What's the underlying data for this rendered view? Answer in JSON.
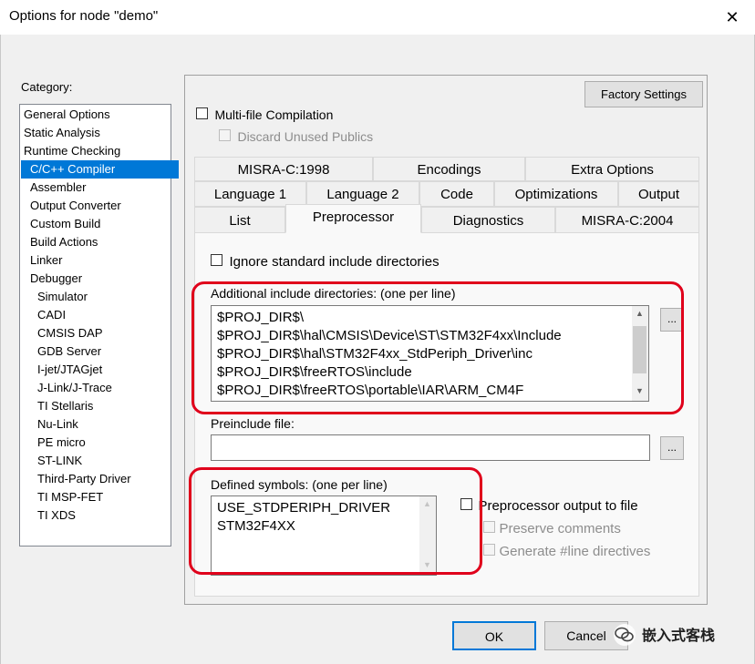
{
  "window": {
    "title": "Options for node \"demo\"",
    "close_glyph": "✕"
  },
  "category": {
    "label": "Category:",
    "items": [
      {
        "label": "General Options",
        "level": 0
      },
      {
        "label": "Static Analysis",
        "level": 0
      },
      {
        "label": "Runtime Checking",
        "level": 0
      },
      {
        "label": "C/C++ Compiler",
        "level": 1,
        "selected": true
      },
      {
        "label": "Assembler",
        "level": 1
      },
      {
        "label": "Output Converter",
        "level": 1
      },
      {
        "label": "Custom Build",
        "level": 1
      },
      {
        "label": "Build Actions",
        "level": 1
      },
      {
        "label": "Linker",
        "level": 1
      },
      {
        "label": "Debugger",
        "level": 1
      },
      {
        "label": "Simulator",
        "level": 2
      },
      {
        "label": "CADI",
        "level": 2
      },
      {
        "label": "CMSIS DAP",
        "level": 2
      },
      {
        "label": "GDB Server",
        "level": 2
      },
      {
        "label": "I-jet/JTAGjet",
        "level": 2
      },
      {
        "label": "J-Link/J-Trace",
        "level": 2
      },
      {
        "label": "TI Stellaris",
        "level": 2
      },
      {
        "label": "Nu-Link",
        "level": 2
      },
      {
        "label": "PE micro",
        "level": 2
      },
      {
        "label": "ST-LINK",
        "level": 2
      },
      {
        "label": "Third-Party Driver",
        "level": 2
      },
      {
        "label": "TI MSP-FET",
        "level": 2
      },
      {
        "label": "TI XDS",
        "level": 2
      }
    ]
  },
  "panel": {
    "factory_settings": "Factory Settings",
    "multi_file": "Multi-file Compilation",
    "discard_unused": "Discard Unused Publics"
  },
  "tabs": {
    "row1": [
      "MISRA-C:1998",
      "Encodings",
      "Extra Options"
    ],
    "row2": [
      "Language 1",
      "Language 2",
      "Code",
      "Optimizations",
      "Output"
    ],
    "row3": [
      "List",
      "Preprocessor",
      "Diagnostics",
      "MISRA-C:2004"
    ],
    "active": "Preprocessor"
  },
  "preprocessor": {
    "ignore_std": "Ignore standard include directories",
    "additional_label": "Additional include directories: (one per line)",
    "include_dirs": [
      "$PROJ_DIR$\\",
      "$PROJ_DIR$\\hal\\CMSIS\\Device\\ST\\STM32F4xx\\Include",
      "$PROJ_DIR$\\hal\\STM32F4xx_StdPeriph_Driver\\inc",
      "$PROJ_DIR$\\freeRTOS\\include",
      "$PROJ_DIR$\\freeRTOS\\portable\\IAR\\ARM_CM4F"
    ],
    "preinclude_label": "Preinclude file:",
    "preinclude_value": "",
    "ellipsis": "...",
    "defined_label": "Defined symbols: (one per line)",
    "defined_symbols": [
      "USE_STDPERIPH_DRIVER",
      "STM32F4XX"
    ],
    "output_to_file": "Preprocessor output to file",
    "preserve_comments": "Preserve comments",
    "generate_line": "Generate #line directives"
  },
  "buttons": {
    "ok": "OK",
    "cancel": "Cancel"
  },
  "watermark": {
    "text": "嵌入式客栈",
    "logo_icon": "wechat-logo-icon"
  },
  "colors": {
    "selection": "#0078d7",
    "highlight": "#e0001b"
  }
}
